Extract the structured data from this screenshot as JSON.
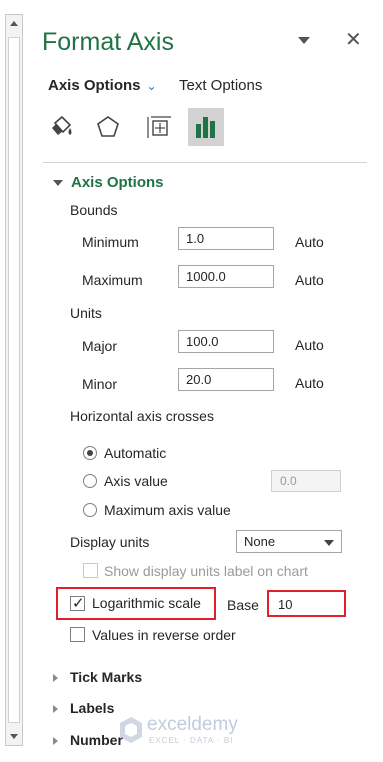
{
  "pane": {
    "title": "Format Axis",
    "tabs": {
      "active": "Axis Options",
      "other": "Text Options"
    },
    "icons": [
      "fill-line-icon",
      "effects-icon",
      "size-properties-icon",
      "axis-options-icon"
    ]
  },
  "axis_options": {
    "header": "Axis Options",
    "bounds": {
      "label": "Bounds",
      "minimum": {
        "label": "Minimum",
        "value": "1.0",
        "auto": "Auto"
      },
      "maximum": {
        "label": "Maximum",
        "value": "1000.0",
        "auto": "Auto"
      }
    },
    "units": {
      "label": "Units",
      "major": {
        "label": "Major",
        "value": "100.0",
        "auto": "Auto"
      },
      "minor": {
        "label": "Minor",
        "value": "20.0",
        "auto": "Auto"
      }
    },
    "crosses": {
      "label": "Horizontal axis crosses",
      "automatic": "Automatic",
      "axis_value": "Axis value",
      "axis_value_input": "0.0",
      "maximum_value": "Maximum axis value",
      "selected": "automatic"
    },
    "display_units": {
      "label": "Display units",
      "value": "None",
      "show_label": "Show display units label on chart"
    },
    "log_scale": {
      "label": "Logarithmic scale",
      "checked": true,
      "base_label": "Base",
      "base_value": "10"
    },
    "reverse_order": {
      "label": "Values in reverse order",
      "checked": false
    }
  },
  "sections": [
    "Tick Marks",
    "Labels",
    "Number"
  ],
  "watermark": {
    "name": "exceldemy",
    "tagline": "EXCEL · DATA · BI"
  },
  "colors": {
    "accent_green": "#217346",
    "highlight_red": "#e0202b",
    "tab_chevron": "#2e75b6"
  }
}
